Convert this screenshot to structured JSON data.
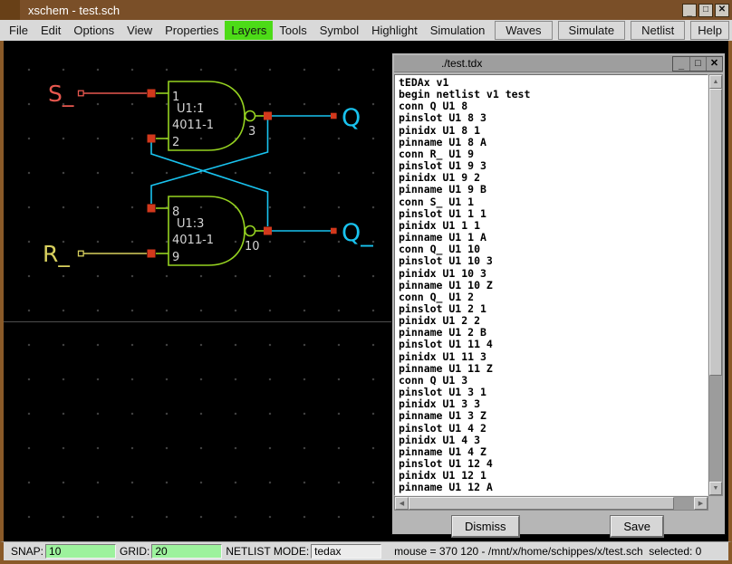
{
  "window": {
    "title": "xschem - test.sch",
    "controls": {
      "minimize": "_",
      "maximize": "□",
      "close": "✕"
    }
  },
  "menubar": {
    "items": [
      "File",
      "Edit",
      "Options",
      "View",
      "Properties",
      "Layers",
      "Tools",
      "Symbol",
      "Highlight",
      "Simulation"
    ],
    "highlighted_item": "Layers",
    "actions": [
      "Waves",
      "Simulate",
      "Netlist",
      "Help"
    ]
  },
  "schematic": {
    "gate_top": {
      "ref": "U1:1",
      "type": "4011-1",
      "pin_in1": "1",
      "pin_in2": "2",
      "pin_out": "3"
    },
    "gate_bottom": {
      "ref": "U1:3",
      "type": "4011-1",
      "pin_in1": "8",
      "pin_in2": "9",
      "pin_out": "10"
    },
    "net_labels": {
      "set": "S_",
      "reset": "R_",
      "q": "Q",
      "q_not": "Q_"
    }
  },
  "dialog": {
    "title": "./test.tdx",
    "content_lines": [
      "tEDAx v1",
      "begin netlist v1 test",
      "conn Q U1 8",
      "pinslot U1 8 3",
      "pinidx U1 8 1",
      "pinname U1 8 A",
      "conn R_ U1 9",
      "pinslot U1 9 3",
      "pinidx U1 9 2",
      "pinname U1 9 B",
      "conn S_ U1 1",
      "pinslot U1 1 1",
      "pinidx U1 1 1",
      "pinname U1 1 A",
      "conn Q_ U1 10",
      "pinslot U1 10 3",
      "pinidx U1 10 3",
      "pinname U1 10 Z",
      "conn Q_ U1 2",
      "pinslot U1 2 1",
      "pinidx U1 2 2",
      "pinname U1 2 B",
      "pinslot U1 11 4",
      "pinidx U1 11 3",
      "pinname U1 11 Z",
      "conn Q U1 3",
      "pinslot U1 3 1",
      "pinidx U1 3 3",
      "pinname U1 3 Z",
      "pinslot U1 4 2",
      "pinidx U1 4 3",
      "pinname U1 4 Z",
      "pinslot U1 12 4",
      "pinidx U1 12 1",
      "pinname U1 12 A"
    ],
    "dismiss_label": "Dismiss",
    "save_label": "Save"
  },
  "statusbar": {
    "snap_label": "SNAP:",
    "snap_value": "10",
    "grid_label": "GRID:",
    "grid_value": "20",
    "netlist_mode_label": "NETLIST MODE:",
    "netlist_mode_value": "tedax",
    "info_text": "mouse = 370 120 - /mnt/x/home/schippes/x/test.sch  selected: 0"
  },
  "colors": {
    "titlebar_brown": "#7a4f28",
    "frame_brown": "#8a5a28",
    "menu_highlight_green": "#4cdb17",
    "gate_green": "#95d220",
    "wire_red": "#e8584f",
    "wire_yellow": "#d8d05e",
    "wire_cyan": "#19c3ef",
    "pin_square_red": "#d2381c",
    "status_field_green": "#9df29d"
  }
}
